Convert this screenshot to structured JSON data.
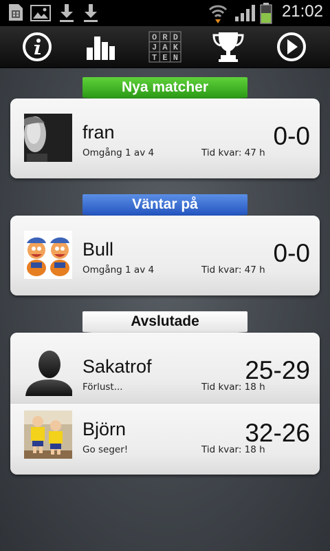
{
  "status_bar": {
    "time": "21:02",
    "icons": [
      "sim-icon",
      "image-icon",
      "download-icon",
      "download-icon",
      "wifi-icon",
      "signal-icon",
      "battery-icon"
    ]
  },
  "toolbar": {
    "buttons": [
      {
        "name": "info-icon"
      },
      {
        "name": "stats-icon"
      },
      {
        "name": "ordjakten-logo",
        "letters": [
          "O",
          "R",
          "D",
          "J",
          "A",
          "K",
          "T",
          "E",
          "N"
        ]
      },
      {
        "name": "trophy-icon"
      },
      {
        "name": "play-icon"
      }
    ]
  },
  "sections": [
    {
      "title": "Nya matcher",
      "color": "#3aa520",
      "matches": [
        {
          "name": "fran",
          "round": "Omgång 1 av 4",
          "time_left": "Tid kvar: 47 h",
          "score": "0-0",
          "avatar": "photo-avatar"
        }
      ]
    },
    {
      "title": "Väntar på",
      "color": "#2f62cc",
      "matches": [
        {
          "name": "Bull",
          "round": "Omgång 1 av 4",
          "time_left": "Tid kvar: 47 h",
          "score": "0-0",
          "avatar": "cartoon-avatar"
        }
      ]
    },
    {
      "title": "Avslutade",
      "color": "#ffffff",
      "matches": [
        {
          "name": "Sakatrof",
          "round": "Förlust...",
          "time_left": "Tid kvar: 18 h",
          "score": "25-29",
          "avatar": "silhouette-avatar"
        },
        {
          "name": "Björn",
          "round": "Go seger!",
          "time_left": "Tid kvar: 18 h",
          "score": "32-26",
          "avatar": "kids-photo-avatar"
        }
      ]
    }
  ]
}
